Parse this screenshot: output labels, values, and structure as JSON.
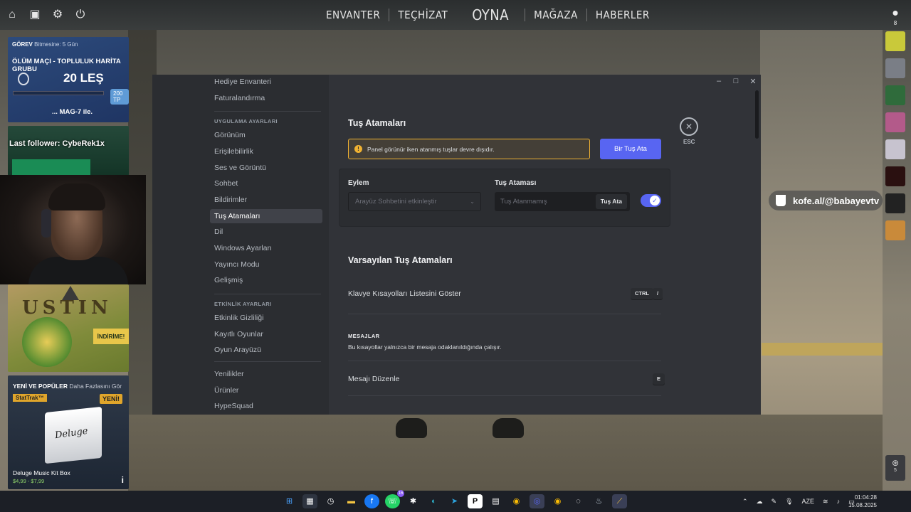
{
  "game": {
    "nav": [
      "ENVANTER",
      "TEÇHİZAT",
      "OYNA",
      "MAĞAZA",
      "HABERLER"
    ],
    "friend_count": "8",
    "promo_mission": {
      "label": "GÖREV",
      "remaining": "Bitmesine: 5 Gün",
      "title": "ÖLÜM MAÇI - TOPLULUK HARİTA GRUBU",
      "kills": "20 LEŞ",
      "reward": "200 TP",
      "weapon": "... MAG-7 ile."
    },
    "follower_text": "Last follower: CybeRek1x",
    "promo_austin": {
      "title": "USTIN",
      "badge": "İNDİRİME!"
    },
    "promo_new": {
      "label": "YENİ VE POPÜLER",
      "more": "Daha Fazlasını Gör",
      "stattrak": "StatTrak™",
      "new_badge": "YENİ!",
      "box_text": "Deluge",
      "name": "Deluge Music Kit Box",
      "price": "$4,99 - $7,99"
    },
    "kofe": "kofe.al/@babayevtv",
    "radio_count": "5"
  },
  "settings": {
    "sidebar": {
      "items_top": [
        "Hediye Envanteri",
        "Faturalandırma"
      ],
      "section_app": "UYGULAMA AYARLARI",
      "app_items": [
        "Görünüm",
        "Erişilebilirlik",
        "Ses ve Görüntü",
        "Sohbet",
        "Bildirimler",
        "Tuş Atamaları",
        "Dil",
        "Windows Ayarları",
        "Yayıncı Modu",
        "Gelişmiş"
      ],
      "section_activity": "ETKİNLİK AYARLARI",
      "activity_items": [
        "Etkinlik Gizliliği",
        "Kayıtlı Oyunlar",
        "Oyun Arayüzü"
      ],
      "misc_items": [
        "Yenilikler",
        "Ürünler",
        "HypeSquad"
      ]
    },
    "title": "Tuş Atamaları",
    "warning": "Panel görünür iken atanmış tuşlar devre dışıdır.",
    "add_button": "Bir Tuş Ata",
    "col_action": "Eylem",
    "col_keybind": "Tuş Ataması",
    "action_select": "Arayüz Sohbetini etkinleştir",
    "keybind_placeholder": "Tuş Atanmamış",
    "keybind_button": "Tuş Ata",
    "default_title": "Varsayılan Tuş Atamaları",
    "rows": [
      {
        "label": "Klavye Kısayolları Listesini Göster",
        "keys": [
          "CTRL",
          "/"
        ]
      }
    ],
    "messages_heading": "MESAJLAR",
    "messages_desc": "Bu kısayollar yalnızca bir mesaja odaklanıldığında çalışır.",
    "edit_label": "Mesajı Düzenle",
    "edit_key": "E",
    "esc_label": "ESC"
  },
  "taskbar": {
    "lang": "AZE",
    "time": "01:04:28",
    "date": "15.08.2025",
    "whatsapp_badge": "16"
  },
  "colors": {
    "accent": "#5865f2",
    "warning": "#f0b232",
    "modal_bg": "#313338",
    "sidebar_bg": "#2b2d31"
  }
}
